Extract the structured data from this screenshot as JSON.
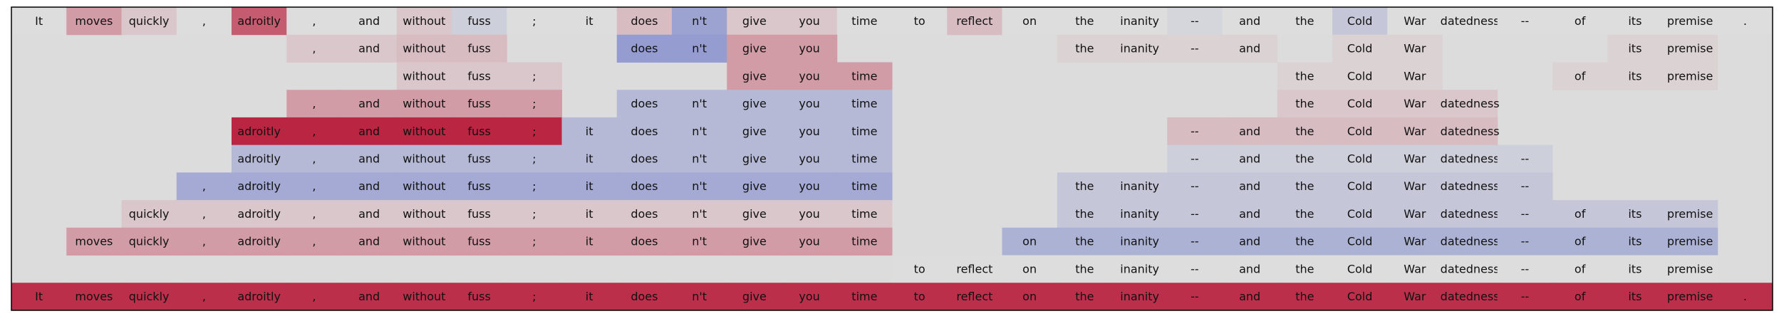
{
  "chart_data": {
    "type": "heatmap",
    "title": "",
    "xlabel": "",
    "ylabel": "",
    "grid": false,
    "legend": "none",
    "empty_cell_color": "#dcdcdc",
    "border_color": "#000000",
    "colormap": {
      "negative": "#3b4cc0",
      "neutral": "#dddddd",
      "positive": "#b40426",
      "range": [
        -1,
        1
      ]
    },
    "tokens": [
      "It",
      "moves",
      "quickly",
      ",",
      "adroitly",
      ",",
      "and",
      "without",
      "fuss",
      ";",
      "it",
      "does",
      "n't",
      "give",
      "you",
      "time",
      "to",
      "reflect",
      "on",
      "the",
      "inanity",
      "--",
      "and",
      "the",
      "Cold",
      "War",
      "datedness",
      "--",
      "of",
      "its",
      "premise",
      "."
    ],
    "rows": [
      {
        "tokens": [
          "It",
          "moves",
          "quickly",
          ",",
          "adroitly",
          ",",
          "and",
          "without",
          "fuss",
          ";",
          "it",
          "does",
          "n't",
          "give",
          "you",
          "time",
          "to",
          "reflect",
          "on",
          "the",
          "inanity",
          "--",
          "and",
          "the",
          "Cold",
          "War",
          "datedness",
          "--",
          "of",
          "its",
          "premise",
          "."
        ],
        "values": [
          0.0,
          0.3,
          0.1,
          0.0,
          0.6,
          0.0,
          0.0,
          0.1,
          -0.1,
          0.0,
          0.0,
          0.15,
          -0.4,
          0.1,
          0.1,
          0.0,
          0.0,
          0.15,
          0.0,
          0.0,
          0.0,
          -0.05,
          0.0,
          0.0,
          -0.15,
          0.0,
          0.0,
          0.0,
          0.0,
          0.0,
          0.0,
          0.0
        ]
      },
      {
        "tokens": [
          null,
          null,
          null,
          null,
          null,
          ",",
          "and",
          "without",
          "fuss",
          null,
          null,
          "does",
          "n't",
          "give",
          "you",
          null,
          null,
          null,
          null,
          "the",
          "inanity",
          "--",
          "and",
          null,
          "Cold",
          "War",
          null,
          null,
          null,
          "its",
          "premise",
          null
        ],
        "values": [
          null,
          null,
          null,
          null,
          null,
          0.1,
          0.1,
          0.15,
          0.15,
          null,
          null,
          -0.45,
          -0.45,
          0.3,
          0.3,
          null,
          null,
          null,
          null,
          0.05,
          0.05,
          0.05,
          0.05,
          null,
          0.05,
          0.05,
          null,
          null,
          null,
          0.05,
          0.05,
          null
        ]
      },
      {
        "tokens": [
          null,
          null,
          null,
          null,
          null,
          null,
          null,
          "without",
          "fuss",
          ";",
          null,
          null,
          null,
          "give",
          "you",
          "time",
          null,
          null,
          null,
          null,
          null,
          null,
          null,
          "the",
          "Cold",
          "War",
          null,
          null,
          "of",
          "its",
          "premise",
          null
        ],
        "values": [
          null,
          null,
          null,
          null,
          null,
          null,
          null,
          0.1,
          0.1,
          0.1,
          null,
          null,
          null,
          0.3,
          0.3,
          0.3,
          null,
          null,
          null,
          null,
          null,
          null,
          null,
          0.05,
          0.05,
          0.05,
          null,
          null,
          0.05,
          0.05,
          0.05,
          null
        ]
      },
      {
        "tokens": [
          null,
          null,
          null,
          null,
          null,
          ",",
          "and",
          "without",
          "fuss",
          ";",
          null,
          "does",
          "n't",
          "give",
          "you",
          "time",
          null,
          null,
          null,
          null,
          null,
          null,
          null,
          "the",
          "Cold",
          "War",
          "datedness",
          null,
          null,
          null,
          null,
          null
        ],
        "values": [
          null,
          null,
          null,
          null,
          null,
          0.3,
          0.3,
          0.3,
          0.3,
          0.3,
          null,
          -0.25,
          -0.25,
          -0.25,
          -0.25,
          -0.25,
          null,
          null,
          null,
          null,
          null,
          null,
          null,
          0.1,
          0.1,
          0.1,
          0.1,
          null,
          null,
          null,
          null,
          null
        ]
      },
      {
        "tokens": [
          null,
          null,
          null,
          null,
          "adroitly",
          ",",
          "and",
          "without",
          "fuss",
          ";",
          "it",
          "does",
          "n't",
          "give",
          "you",
          "time",
          null,
          null,
          null,
          null,
          null,
          "--",
          "and",
          "the",
          "Cold",
          "War",
          "datedness",
          null,
          null,
          null,
          null,
          null
        ],
        "values": [
          null,
          null,
          null,
          null,
          0.85,
          0.85,
          0.85,
          0.85,
          0.85,
          0.85,
          -0.25,
          -0.25,
          -0.25,
          -0.25,
          -0.25,
          -0.25,
          null,
          null,
          null,
          null,
          null,
          0.15,
          0.15,
          0.15,
          0.15,
          0.15,
          0.15,
          null,
          null,
          null,
          null,
          null
        ]
      },
      {
        "tokens": [
          null,
          null,
          null,
          null,
          "adroitly",
          ",",
          "and",
          "without",
          "fuss",
          ";",
          "it",
          "does",
          "n't",
          "give",
          "you",
          "time",
          null,
          null,
          null,
          null,
          null,
          "--",
          "and",
          "the",
          "Cold",
          "War",
          "datedness",
          "--",
          null,
          null,
          null,
          null
        ],
        "values": [
          null,
          null,
          null,
          null,
          -0.25,
          -0.25,
          -0.25,
          -0.25,
          -0.25,
          -0.25,
          -0.25,
          -0.25,
          -0.25,
          -0.25,
          -0.25,
          -0.25,
          null,
          null,
          null,
          null,
          null,
          -0.1,
          -0.1,
          -0.1,
          -0.1,
          -0.1,
          -0.1,
          -0.1,
          null,
          null,
          null,
          null
        ]
      },
      {
        "tokens": [
          null,
          null,
          null,
          ",",
          "adroitly",
          ",",
          "and",
          "without",
          "fuss",
          ";",
          "it",
          "does",
          "n't",
          "give",
          "you",
          "time",
          null,
          null,
          null,
          "the",
          "inanity",
          "--",
          "and",
          "the",
          "Cold",
          "War",
          "datedness",
          "--",
          null,
          null,
          null,
          null
        ],
        "values": [
          null,
          null,
          null,
          -0.35,
          -0.35,
          -0.35,
          -0.35,
          -0.35,
          -0.35,
          -0.35,
          -0.35,
          -0.35,
          -0.35,
          -0.35,
          -0.35,
          -0.35,
          null,
          null,
          null,
          -0.15,
          -0.15,
          -0.15,
          -0.15,
          -0.15,
          -0.15,
          -0.15,
          -0.15,
          -0.15,
          null,
          null,
          null,
          null
        ]
      },
      {
        "tokens": [
          null,
          null,
          "quickly",
          ",",
          "adroitly",
          ",",
          "and",
          "without",
          "fuss",
          ";",
          "it",
          "does",
          "n't",
          "give",
          "you",
          "time",
          null,
          null,
          null,
          "the",
          "inanity",
          "--",
          "and",
          "the",
          "Cold",
          "War",
          "datedness",
          "--",
          "of",
          "its",
          "premise",
          null
        ],
        "values": [
          null,
          null,
          0.1,
          0.1,
          0.1,
          0.1,
          0.1,
          0.1,
          0.1,
          0.1,
          0.1,
          0.1,
          0.1,
          0.1,
          0.1,
          0.1,
          null,
          null,
          null,
          -0.15,
          -0.15,
          -0.15,
          -0.15,
          -0.15,
          -0.15,
          -0.15,
          -0.15,
          -0.15,
          -0.15,
          -0.15,
          -0.15,
          null
        ]
      },
      {
        "tokens": [
          null,
          "moves",
          "quickly",
          ",",
          "adroitly",
          ",",
          "and",
          "without",
          "fuss",
          ";",
          "it",
          "does",
          "n't",
          "give",
          "you",
          "time",
          null,
          null,
          "on",
          "the",
          "inanity",
          "--",
          "and",
          "the",
          "Cold",
          "War",
          "datedness",
          "--",
          "of",
          "its",
          "premise",
          null
        ],
        "values": [
          null,
          0.3,
          0.3,
          0.3,
          0.3,
          0.3,
          0.3,
          0.3,
          0.3,
          0.3,
          0.3,
          0.3,
          0.3,
          0.3,
          0.3,
          0.3,
          null,
          null,
          -0.3,
          -0.3,
          -0.3,
          -0.3,
          -0.3,
          -0.3,
          -0.3,
          -0.3,
          -0.3,
          -0.3,
          -0.3,
          -0.3,
          -0.3,
          null
        ]
      },
      {
        "tokens": [
          null,
          null,
          null,
          null,
          null,
          null,
          null,
          null,
          null,
          null,
          null,
          null,
          null,
          null,
          null,
          null,
          "to",
          "reflect",
          "on",
          "the",
          "inanity",
          "--",
          "and",
          "the",
          "Cold",
          "War",
          "datedness",
          "--",
          "of",
          "its",
          "premise",
          null
        ],
        "values": [
          null,
          null,
          null,
          null,
          null,
          null,
          null,
          null,
          null,
          null,
          null,
          null,
          null,
          null,
          null,
          null,
          0.0,
          0.0,
          0.0,
          0.0,
          0.0,
          0.0,
          0.0,
          0.0,
          0.0,
          0.0,
          0.0,
          0.0,
          0.0,
          0.0,
          0.0,
          null
        ]
      },
      {
        "tokens": [
          "It",
          "moves",
          "quickly",
          ",",
          "adroitly",
          ",",
          "and",
          "without",
          "fuss",
          ";",
          "it",
          "does",
          "n't",
          "give",
          "you",
          "time",
          "to",
          "reflect",
          "on",
          "the",
          "inanity",
          "--",
          "and",
          "the",
          "Cold",
          "War",
          "datedness",
          "--",
          "of",
          "its",
          "premise",
          "."
        ],
        "values": [
          0.8,
          0.8,
          0.8,
          0.8,
          0.8,
          0.8,
          0.8,
          0.8,
          0.8,
          0.8,
          0.8,
          0.8,
          0.8,
          0.8,
          0.8,
          0.8,
          0.8,
          0.8,
          0.8,
          0.8,
          0.8,
          0.8,
          0.8,
          0.8,
          0.8,
          0.8,
          0.8,
          0.8,
          0.8,
          0.8,
          0.8,
          0.8
        ]
      }
    ]
  }
}
